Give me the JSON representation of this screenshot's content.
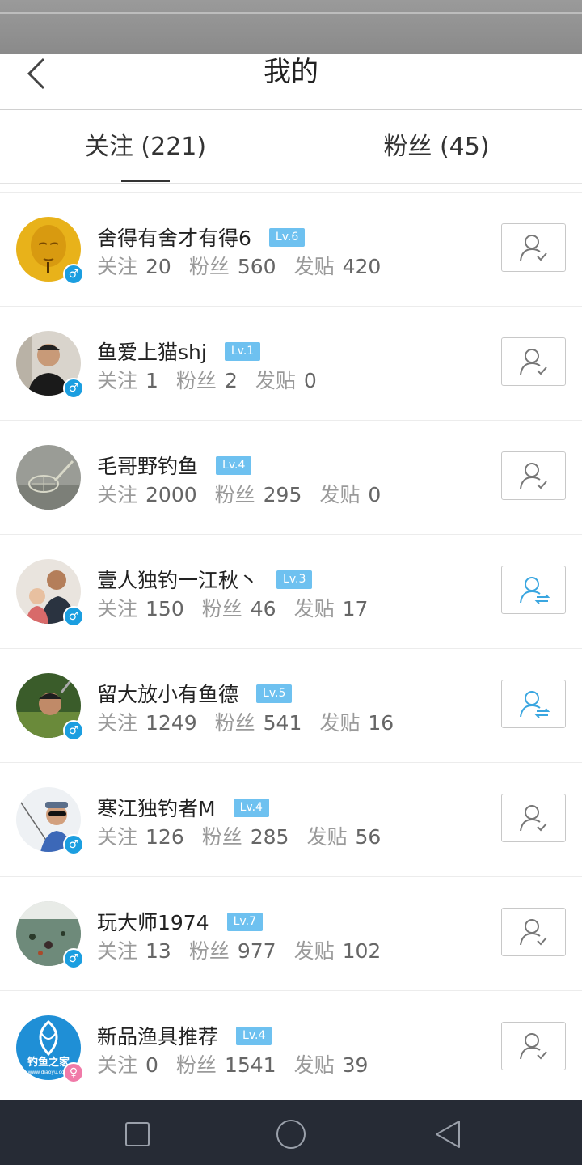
{
  "header": {
    "title": "我的"
  },
  "tabs": [
    {
      "label": "关注 (221)",
      "active": true
    },
    {
      "label": "粉丝 (45)",
      "active": false
    }
  ],
  "stat_labels": {
    "following": "关注",
    "fans": "粉丝",
    "posts": "发贴"
  },
  "colors": {
    "accent_blue": "#1b9ee0",
    "level_badge": "#6ec1f0",
    "mutual_icon": "#3aa6e0",
    "female_badge": "#f07aa8",
    "nav_bar": "#262b35"
  },
  "users": [
    {
      "name": "舍得有舍才有得6",
      "level": "Lv.6",
      "following": "20",
      "fans": "560",
      "posts": "420",
      "gender": "male",
      "status": "following",
      "avatar": "golden-buddha"
    },
    {
      "name": "鱼爱上猫shj",
      "level": "Lv.1",
      "following": "1",
      "fans": "2",
      "posts": "0",
      "gender": "male",
      "status": "following",
      "avatar": "man-portrait"
    },
    {
      "name": "毛哥野钓鱼",
      "level": "Lv.4",
      "following": "2000",
      "fans": "295",
      "posts": "0",
      "gender": "none",
      "status": "following",
      "avatar": "fishing-net"
    },
    {
      "name": "壹人独钓一江秋丶",
      "level": "Lv.3",
      "following": "150",
      "fans": "46",
      "posts": "17",
      "gender": "male",
      "status": "mutual",
      "avatar": "family-photo"
    },
    {
      "name": "留大放小有鱼德",
      "level": "Lv.5",
      "following": "1249",
      "fans": "541",
      "posts": "16",
      "gender": "male",
      "status": "mutual",
      "avatar": "selfie"
    },
    {
      "name": "寒江独钓者M",
      "level": "Lv.4",
      "following": "126",
      "fans": "285",
      "posts": "56",
      "gender": "male",
      "status": "following",
      "avatar": "angler-sunglasses"
    },
    {
      "name": "玩大师1974",
      "level": "Lv.7",
      "following": "13",
      "fans": "977",
      "posts": "102",
      "gender": "male",
      "status": "following",
      "avatar": "lake-scene"
    },
    {
      "name": "新品渔具推荐",
      "level": "Lv.4",
      "following": "0",
      "fans": "1541",
      "posts": "39",
      "gender": "female",
      "status": "following",
      "avatar": "diaoyu-logo"
    }
  ],
  "logo_text": "钓鱼之家",
  "gender_symbols": {
    "male": "♂",
    "female": "♀"
  }
}
